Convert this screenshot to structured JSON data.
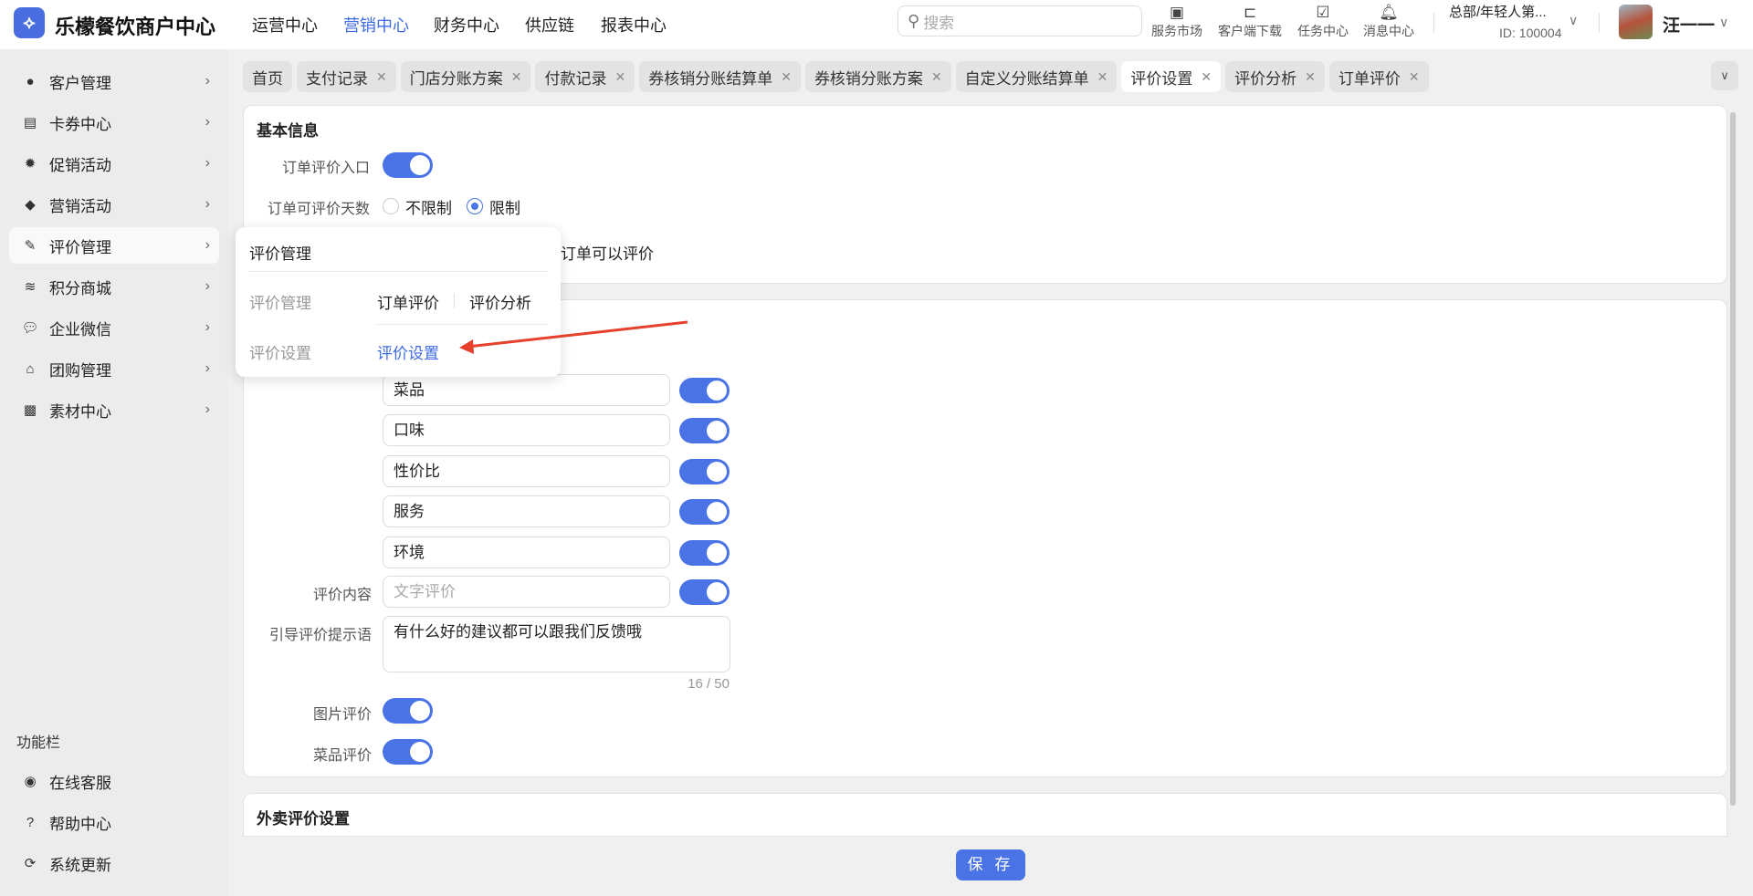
{
  "header": {
    "brand": "乐檬餐饮商户中心",
    "nav": [
      "运营中心",
      "营销中心",
      "财务中心",
      "供应链",
      "报表中心"
    ],
    "active_nav": 1,
    "search_placeholder": "搜索",
    "tools": [
      {
        "label": "服务市场",
        "icon": "briefcase-icon"
      },
      {
        "label": "客户端下载",
        "icon": "folder-download-icon"
      },
      {
        "label": "任务中心",
        "icon": "clipboard-check-icon"
      },
      {
        "label": "消息中心",
        "icon": "bell-icon"
      }
    ],
    "org": "总部/年轻人第...",
    "org_id": "ID: 100004",
    "user": "汪一一"
  },
  "sidebar": {
    "items": [
      "客户管理",
      "卡券中心",
      "促销活动",
      "营销活动",
      "评价管理",
      "积分商城",
      "企业微信",
      "团购管理",
      "素材中心"
    ],
    "active": 4,
    "section": "功能栏",
    "bottom": [
      "在线客服",
      "帮助中心",
      "系统更新"
    ]
  },
  "tabs": [
    {
      "label": "首页"
    },
    {
      "label": "支付记录"
    },
    {
      "label": "门店分账方案"
    },
    {
      "label": "付款记录"
    },
    {
      "label": "券核销分账结算单"
    },
    {
      "label": "券核销分账方案"
    },
    {
      "label": "自定义分账结算单"
    },
    {
      "label": "评价设置"
    },
    {
      "label": "评价分析"
    },
    {
      "label": "订单评价"
    }
  ],
  "active_tab": 7,
  "basic": {
    "title": "基本信息",
    "entry_label": "订单评价入口",
    "entry_on": true,
    "days_label": "订单可评价天数",
    "opt_unlimited": "不限制",
    "opt_limited": "限制",
    "selected": "限制",
    "days_tail": "订单可以评价"
  },
  "popup": {
    "title": "评价管理",
    "group1": "评价管理",
    "links1": [
      "订单评价",
      "评价分析"
    ],
    "group2": "评价设置",
    "link2": "评价设置"
  },
  "review": {
    "dimensions": [
      {
        "value": "菜品",
        "on": true
      },
      {
        "value": "口味",
        "on": true
      },
      {
        "value": "性价比",
        "on": true
      },
      {
        "value": "服务",
        "on": true
      },
      {
        "value": "环境",
        "on": true
      }
    ],
    "content_label": "评价内容",
    "content_placeholder": "文字评价",
    "content_on": true,
    "prompt_label": "引导评价提示语",
    "prompt_value": "有什么好的建议都可以跟我们反馈哦",
    "prompt_count": "16 / 50",
    "photo_label": "图片评价",
    "photo_on": true,
    "dish_label": "菜品评价",
    "dish_on": true
  },
  "takeout": {
    "title": "外卖评价设置"
  },
  "save_label": "保 存",
  "colors": {
    "accent": "#4a74e6",
    "arrow": "#e5412d"
  }
}
